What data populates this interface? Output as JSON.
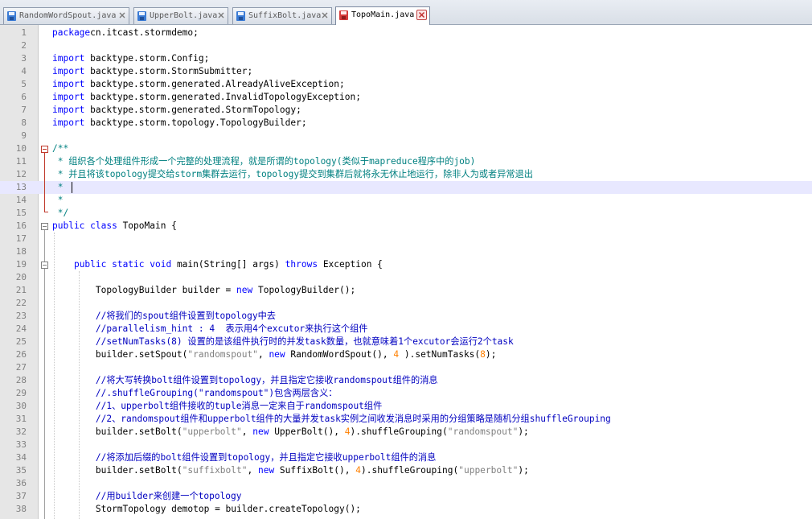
{
  "tabs": [
    {
      "label": "RandomWordSpout.java",
      "active": false,
      "icon": "save-disk-icon"
    },
    {
      "label": "UpperBolt.java",
      "active": false,
      "icon": "save-disk-icon"
    },
    {
      "label": "SuffixBolt.java",
      "active": false,
      "icon": "save-disk-icon"
    },
    {
      "label": "TopoMain.java",
      "active": true,
      "icon": "unsaved-disk-icon"
    }
  ],
  "colors": {
    "keyword": "#0000ff",
    "doc_comment": "#008080",
    "line_comment": "#0000c0",
    "string": "#808080",
    "number": "#ff8000",
    "current_line": "#e8e8ff"
  },
  "current_line": 13,
  "lines": [
    {
      "n": "1",
      "segs": [
        [
          "kw",
          "package"
        ],
        [
          "",
          "cn.itcast.stormdemo;"
        ]
      ]
    },
    {
      "n": "2",
      "segs": []
    },
    {
      "n": "3",
      "segs": [
        [
          "kw",
          "import"
        ],
        [
          "",
          " backtype.storm.Config;"
        ]
      ]
    },
    {
      "n": "4",
      "segs": [
        [
          "kw",
          "import"
        ],
        [
          "",
          " backtype.storm.StormSubmitter;"
        ]
      ]
    },
    {
      "n": "5",
      "segs": [
        [
          "kw",
          "import"
        ],
        [
          "",
          " backtype.storm.generated.AlreadyAliveException;"
        ]
      ]
    },
    {
      "n": "6",
      "segs": [
        [
          "kw",
          "import"
        ],
        [
          "",
          " backtype.storm.generated.InvalidTopologyException;"
        ]
      ]
    },
    {
      "n": "7",
      "segs": [
        [
          "kw",
          "import"
        ],
        [
          "",
          " backtype.storm.generated.StormTopology;"
        ]
      ]
    },
    {
      "n": "8",
      "segs": [
        [
          "kw",
          "import"
        ],
        [
          "",
          " backtype.storm.topology.TopologyBuilder;"
        ]
      ]
    },
    {
      "n": "9",
      "segs": []
    },
    {
      "n": "10",
      "segs": [
        [
          "doc",
          "/**"
        ]
      ]
    },
    {
      "n": "11",
      "segs": [
        [
          "doc",
          " * 组织各个处理组件形成一个完整的处理流程，就是所谓的topology(类似于mapreduce程序中的job)"
        ]
      ]
    },
    {
      "n": "12",
      "segs": [
        [
          "doc",
          " * 并且将该topology提交给storm集群去运行，topology提交到集群后就将永无休止地运行，除非人为或者异常退出"
        ]
      ]
    },
    {
      "n": "13",
      "segs": [
        [
          "doc",
          " * "
        ]
      ]
    },
    {
      "n": "14",
      "segs": [
        [
          "doc",
          " *"
        ]
      ]
    },
    {
      "n": "15",
      "segs": [
        [
          "doc",
          " */"
        ]
      ]
    },
    {
      "n": "16",
      "segs": [
        [
          "kw",
          "public class"
        ],
        [
          "",
          " TopoMain {"
        ]
      ]
    },
    {
      "n": "17",
      "segs": []
    },
    {
      "n": "18",
      "segs": []
    },
    {
      "n": "19",
      "segs": [
        [
          "",
          "    "
        ],
        [
          "kw",
          "public static void"
        ],
        [
          "",
          " main(String[] args) "
        ],
        [
          "kw",
          "throws"
        ],
        [
          "",
          " Exception {"
        ]
      ]
    },
    {
      "n": "20",
      "segs": []
    },
    {
      "n": "21",
      "segs": [
        [
          "",
          "        TopologyBuilder builder = "
        ],
        [
          "kw",
          "new"
        ],
        [
          "",
          " TopologyBuilder();"
        ]
      ]
    },
    {
      "n": "22",
      "segs": []
    },
    {
      "n": "23",
      "segs": [
        [
          "cm",
          "        //将我们的spout组件设置到topology中去"
        ]
      ]
    },
    {
      "n": "24",
      "segs": [
        [
          "cm",
          "        //parallelism_hint : 4  表示用4个excutor来执行这个组件"
        ]
      ]
    },
    {
      "n": "25",
      "segs": [
        [
          "cm",
          "        //setNumTasks(8) 设置的是该组件执行时的并发task数量，也就意味着1个excutor会运行2个task"
        ]
      ]
    },
    {
      "n": "26",
      "segs": [
        [
          "",
          "        builder.setSpout("
        ],
        [
          "str",
          "\"randomspout\""
        ],
        [
          "",
          ", "
        ],
        [
          "kw",
          "new"
        ],
        [
          "",
          " RandomWordSpout(), "
        ],
        [
          "num",
          "4"
        ],
        [
          "",
          " ).setNumTasks("
        ],
        [
          "num",
          "8"
        ],
        [
          "",
          ");"
        ]
      ]
    },
    {
      "n": "27",
      "segs": []
    },
    {
      "n": "28",
      "segs": [
        [
          "cm",
          "        //将大写转换bolt组件设置到topology，并且指定它接收randomspout组件的消息"
        ]
      ]
    },
    {
      "n": "29",
      "segs": [
        [
          "cm",
          "        //.shuffleGrouping(\"randomspout\")包含两层含义："
        ]
      ]
    },
    {
      "n": "30",
      "segs": [
        [
          "cm",
          "        //1、upperbolt组件接收的tuple消息一定来自于randomspout组件"
        ]
      ]
    },
    {
      "n": "31",
      "segs": [
        [
          "cm",
          "        //2、randomspout组件和upperbolt组件的大量并发task实例之间收发消息时采用的分组策略是随机分组shuffleGrouping"
        ]
      ]
    },
    {
      "n": "32",
      "segs": [
        [
          "",
          "        builder.setBolt("
        ],
        [
          "str",
          "\"upperbolt\""
        ],
        [
          "",
          ", "
        ],
        [
          "kw",
          "new"
        ],
        [
          "",
          " UpperBolt(), "
        ],
        [
          "num",
          "4"
        ],
        [
          "",
          ").shuffleGrouping("
        ],
        [
          "str",
          "\"randomspout\""
        ],
        [
          "",
          ");"
        ]
      ]
    },
    {
      "n": "33",
      "segs": []
    },
    {
      "n": "34",
      "segs": [
        [
          "cm",
          "        //将添加后缀的bolt组件设置到topology，并且指定它接收upperbolt组件的消息"
        ]
      ]
    },
    {
      "n": "35",
      "segs": [
        [
          "",
          "        builder.setBolt("
        ],
        [
          "str",
          "\"suffixbolt\""
        ],
        [
          "",
          ", "
        ],
        [
          "kw",
          "new"
        ],
        [
          "",
          " SuffixBolt(), "
        ],
        [
          "num",
          "4"
        ],
        [
          "",
          ").shuffleGrouping("
        ],
        [
          "str",
          "\"upperbolt\""
        ],
        [
          "",
          ");"
        ]
      ]
    },
    {
      "n": "36",
      "segs": []
    },
    {
      "n": "37",
      "segs": [
        [
          "cm",
          "        //用builder来创建一个topology"
        ]
      ]
    },
    {
      "n": "38",
      "segs": [
        [
          "",
          "        StormTopology demotop = builder.createTopology();"
        ]
      ]
    }
  ]
}
